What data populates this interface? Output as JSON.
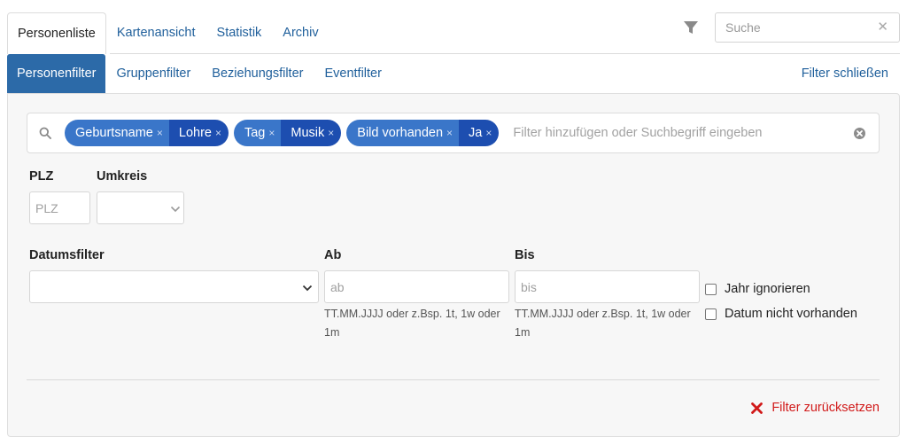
{
  "top_tabs": [
    {
      "label": "Personenliste",
      "active": true
    },
    {
      "label": "Kartenansicht",
      "active": false
    },
    {
      "label": "Statistik",
      "active": false
    },
    {
      "label": "Archiv",
      "active": false
    }
  ],
  "search": {
    "placeholder": "Suche",
    "value": "",
    "clear_icon": "close-icon"
  },
  "sub_tabs": [
    {
      "label": "Personenfilter",
      "active": true
    },
    {
      "label": "Gruppenfilter",
      "active": false
    },
    {
      "label": "Beziehungsfilter",
      "active": false
    },
    {
      "label": "Eventfilter",
      "active": false
    }
  ],
  "close_filter_label": "Filter schließen",
  "chips": [
    {
      "key": "Geburtsname",
      "value": "Lohre"
    },
    {
      "key": "Tag",
      "value": "Musik"
    },
    {
      "key": "Bild vorhanden",
      "value": "Ja"
    }
  ],
  "chip_remove_glyph": "×",
  "chip_input_placeholder": "Filter hinzufügen oder Suchbegriff eingeben",
  "plz": {
    "label": "PLZ",
    "placeholder": "PLZ",
    "value": ""
  },
  "umkreis": {
    "label": "Umkreis",
    "value": ""
  },
  "datumsfilter": {
    "label": "Datumsfilter",
    "value": ""
  },
  "ab": {
    "label": "Ab",
    "placeholder": "ab",
    "hint": "TT.MM.JJJJ oder z.Bsp. 1t, 1w oder 1m"
  },
  "bis": {
    "label": "Bis",
    "placeholder": "bis",
    "hint": "TT.MM.JJJJ oder z.Bsp. 1t, 1w oder 1m"
  },
  "checkboxes": [
    {
      "label": "Jahr ignorieren",
      "checked": false
    },
    {
      "label": "Datum nicht vorhanden",
      "checked": false
    }
  ],
  "reset_label": "Filter zurücksetzen",
  "colors": {
    "accent": "#2c6aa8",
    "link": "#1f5f9b",
    "chip_key": "#3a76c9",
    "chip_value": "#1d4eb0",
    "danger": "#d11a1a"
  }
}
